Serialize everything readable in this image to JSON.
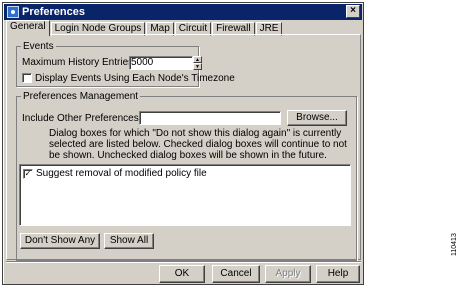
{
  "window": {
    "title": "Preferences",
    "close_glyph": "×"
  },
  "tabs": [
    {
      "label": "General",
      "active": true
    },
    {
      "label": "Login Node Groups",
      "active": false
    },
    {
      "label": "Map",
      "active": false
    },
    {
      "label": "Circuit",
      "active": false
    },
    {
      "label": "Firewall",
      "active": false
    },
    {
      "label": "JRE",
      "active": false
    }
  ],
  "events": {
    "legend": "Events",
    "max_history_label": "Maximum History Entries:",
    "max_history_value": "5000",
    "display_timezone_label": "Display Events Using Each Node's Timezone",
    "display_timezone_checked": false
  },
  "prefs": {
    "legend": "Preferences Management",
    "include_label": "Include Other Preferences File:",
    "include_value": "",
    "browse_label": "Browse...",
    "info_text": "Dialog boxes for which \"Do not show this dialog again\" is currently selected are listed below. Checked dialog boxes will continue to not be shown. Unchecked dialog boxes will be shown in the future.",
    "list_items": [
      {
        "label": "Suggest removal of modified policy file",
        "checked": true
      }
    ],
    "dont_show_any_label": "Don't Show Any",
    "show_all_label": "Show All"
  },
  "footer": {
    "ok": "OK",
    "cancel": "Cancel",
    "apply": "Apply",
    "help": "Help"
  },
  "side_id": "110413",
  "icons": {
    "spin_up": "▲",
    "spin_down": "▼",
    "check_mark": "✓"
  }
}
